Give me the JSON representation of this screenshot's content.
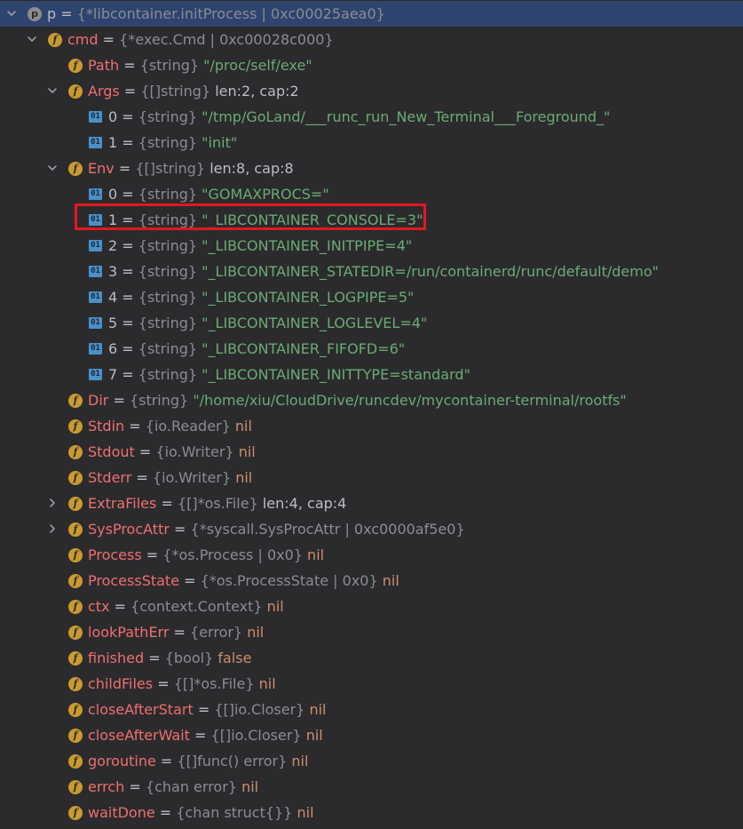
{
  "rows": [
    {
      "depth": 0,
      "arrow": "down",
      "icon": "var",
      "icon_label": "p",
      "name": "p",
      "plain": true,
      "type": "{*libcontainer.initProcess | 0xc00025aea0}",
      "value": "",
      "vclass": "",
      "selected": true
    },
    {
      "depth": 1,
      "arrow": "down",
      "icon": "field",
      "icon_label": "f",
      "name": "cmd",
      "type": "{*exec.Cmd | 0xc00028c000}",
      "value": "",
      "vclass": ""
    },
    {
      "depth": 2,
      "arrow": "",
      "icon": "field",
      "icon_label": "f",
      "name": "Path",
      "type": "{string}",
      "value": "\"/proc/self/exe\"",
      "vclass": "str"
    },
    {
      "depth": 2,
      "arrow": "down",
      "icon": "field",
      "icon_label": "f",
      "name": "Args",
      "type": "{[]string}",
      "value": "len:2, cap:2",
      "vclass": "info"
    },
    {
      "depth": 3,
      "arrow": "",
      "icon": "elem",
      "icon_label": "01",
      "name": "0",
      "plain": true,
      "type": "{string}",
      "value": "\"/tmp/GoLand/___runc_run_New_Terminal___Foreground_\"",
      "vclass": "str"
    },
    {
      "depth": 3,
      "arrow": "",
      "icon": "elem",
      "icon_label": "01",
      "name": "1",
      "plain": true,
      "type": "{string}",
      "value": "\"init\"",
      "vclass": "str"
    },
    {
      "depth": 2,
      "arrow": "down",
      "icon": "field",
      "icon_label": "f",
      "name": "Env",
      "type": "{[]string}",
      "value": "len:8, cap:8",
      "vclass": "info"
    },
    {
      "depth": 3,
      "arrow": "",
      "icon": "elem",
      "icon_label": "01",
      "name": "0",
      "plain": true,
      "type": "{string}",
      "value": "\"GOMAXPROCS=\"",
      "vclass": "str"
    },
    {
      "depth": 3,
      "arrow": "",
      "icon": "elem",
      "icon_label": "01",
      "name": "1",
      "plain": true,
      "type": "{string}",
      "value": "\"_LIBCONTAINER_CONSOLE=3\"",
      "vclass": "str"
    },
    {
      "depth": 3,
      "arrow": "",
      "icon": "elem",
      "icon_label": "01",
      "name": "2",
      "plain": true,
      "type": "{string}",
      "value": "\"_LIBCONTAINER_INITPIPE=4\"",
      "vclass": "str"
    },
    {
      "depth": 3,
      "arrow": "",
      "icon": "elem",
      "icon_label": "01",
      "name": "3",
      "plain": true,
      "type": "{string}",
      "value": "\"_LIBCONTAINER_STATEDIR=/run/containerd/runc/default/demo\"",
      "vclass": "str"
    },
    {
      "depth": 3,
      "arrow": "",
      "icon": "elem",
      "icon_label": "01",
      "name": "4",
      "plain": true,
      "type": "{string}",
      "value": "\"_LIBCONTAINER_LOGPIPE=5\"",
      "vclass": "str"
    },
    {
      "depth": 3,
      "arrow": "",
      "icon": "elem",
      "icon_label": "01",
      "name": "5",
      "plain": true,
      "type": "{string}",
      "value": "\"_LIBCONTAINER_LOGLEVEL=4\"",
      "vclass": "str"
    },
    {
      "depth": 3,
      "arrow": "",
      "icon": "elem",
      "icon_label": "01",
      "name": "6",
      "plain": true,
      "type": "{string}",
      "value": "\"_LIBCONTAINER_FIFOFD=6\"",
      "vclass": "str"
    },
    {
      "depth": 3,
      "arrow": "",
      "icon": "elem",
      "icon_label": "01",
      "name": "7",
      "plain": true,
      "type": "{string}",
      "value": "\"_LIBCONTAINER_INITTYPE=standard\"",
      "vclass": "str"
    },
    {
      "depth": 2,
      "arrow": "",
      "icon": "field",
      "icon_label": "f",
      "name": "Dir",
      "type": "{string}",
      "value": "\"/home/xiu/CloudDrive/runcdev/mycontainer-terminal/rootfs\"",
      "vclass": "str"
    },
    {
      "depth": 2,
      "arrow": "",
      "icon": "field",
      "icon_label": "f",
      "name": "Stdin",
      "type": "{io.Reader}",
      "value": "nil",
      "vclass": "kw"
    },
    {
      "depth": 2,
      "arrow": "",
      "icon": "field",
      "icon_label": "f",
      "name": "Stdout",
      "type": "{io.Writer}",
      "value": "nil",
      "vclass": "kw"
    },
    {
      "depth": 2,
      "arrow": "",
      "icon": "field",
      "icon_label": "f",
      "name": "Stderr",
      "type": "{io.Writer}",
      "value": "nil",
      "vclass": "kw"
    },
    {
      "depth": 2,
      "arrow": "right",
      "icon": "field",
      "icon_label": "f",
      "name": "ExtraFiles",
      "type": "{[]*os.File}",
      "value": "len:4, cap:4",
      "vclass": "info"
    },
    {
      "depth": 2,
      "arrow": "right",
      "icon": "field",
      "icon_label": "f",
      "name": "SysProcAttr",
      "type": "{*syscall.SysProcAttr | 0xc0000af5e0}",
      "value": "",
      "vclass": ""
    },
    {
      "depth": 2,
      "arrow": "",
      "icon": "field",
      "icon_label": "f",
      "name": "Process",
      "type": "{*os.Process | 0x0}",
      "value": "nil",
      "vclass": "kw"
    },
    {
      "depth": 2,
      "arrow": "",
      "icon": "field",
      "icon_label": "f",
      "name": "ProcessState",
      "type": "{*os.ProcessState | 0x0}",
      "value": "nil",
      "vclass": "kw"
    },
    {
      "depth": 2,
      "arrow": "",
      "icon": "field",
      "icon_label": "f",
      "name": "ctx",
      "type": "{context.Context}",
      "value": "nil",
      "vclass": "kw"
    },
    {
      "depth": 2,
      "arrow": "",
      "icon": "field",
      "icon_label": "f",
      "name": "lookPathErr",
      "type": "{error}",
      "value": "nil",
      "vclass": "kw"
    },
    {
      "depth": 2,
      "arrow": "",
      "icon": "field",
      "icon_label": "f",
      "name": "finished",
      "type": "{bool}",
      "value": "false",
      "vclass": "kw"
    },
    {
      "depth": 2,
      "arrow": "",
      "icon": "field",
      "icon_label": "f",
      "name": "childFiles",
      "type": "{[]*os.File}",
      "value": "nil",
      "vclass": "kw"
    },
    {
      "depth": 2,
      "arrow": "",
      "icon": "field",
      "icon_label": "f",
      "name": "closeAfterStart",
      "type": "{[]io.Closer}",
      "value": "nil",
      "vclass": "kw"
    },
    {
      "depth": 2,
      "arrow": "",
      "icon": "field",
      "icon_label": "f",
      "name": "closeAfterWait",
      "type": "{[]io.Closer}",
      "value": "nil",
      "vclass": "kw"
    },
    {
      "depth": 2,
      "arrow": "",
      "icon": "field",
      "icon_label": "f",
      "name": "goroutine",
      "type": "{[]func() error}",
      "value": "nil",
      "vclass": "kw"
    },
    {
      "depth": 2,
      "arrow": "",
      "icon": "field",
      "icon_label": "f",
      "name": "errch",
      "type": "{chan error}",
      "value": "nil",
      "vclass": "kw"
    },
    {
      "depth": 2,
      "arrow": "",
      "icon": "field",
      "icon_label": "f",
      "name": "waitDone",
      "type": "{chan struct{}}",
      "value": "nil",
      "vclass": "kw"
    }
  ],
  "equals_sign": "=",
  "colors": {
    "background": "#2b2b2d",
    "selected_row": "#2e436e",
    "field_name": "#ef6f6f",
    "string_value": "#6aab73",
    "keyword_value": "#cf8e6d",
    "type_text": "#8a8d93",
    "highlight_box": "#e2191e"
  }
}
